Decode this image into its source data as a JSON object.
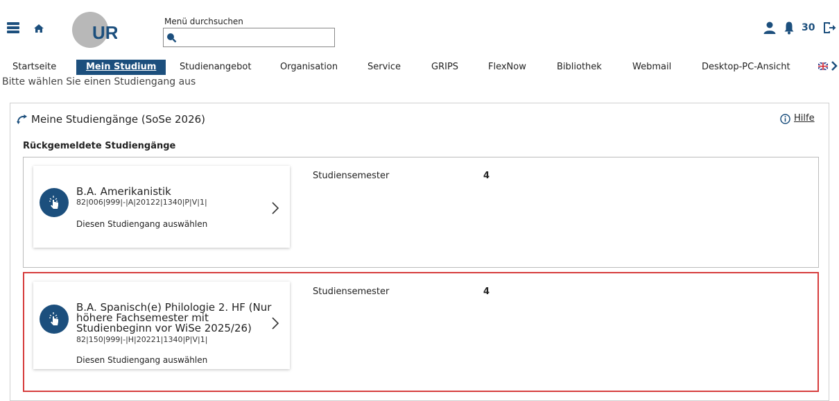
{
  "header": {
    "search_label": "Menü durchsuchen",
    "search_value": "",
    "notification_count": "30"
  },
  "nav": {
    "items": [
      "Startseite",
      "Mein Studium",
      "Studienangebot",
      "Organisation",
      "Service",
      "GRIPS",
      "FlexNow",
      "Bibliothek",
      "Webmail",
      "Desktop-PC-Ansicht"
    ],
    "active_index": 1
  },
  "page": {
    "title": "Bitte wählen Sie einen Studiengang aus",
    "panel_title": "Meine Studiengänge (SoSe 2026)",
    "help_label": "Hilfe",
    "section_title": "Rückgemeldete Studiengänge"
  },
  "courses": [
    {
      "title": "B.A. Amerikanistik",
      "code": "82|006|999|-|A|20122|1340|P|V|1|",
      "action": "Diesen Studiengang auswählen",
      "meta_label": "Studiensemester",
      "meta_value": "4"
    },
    {
      "title_lines": [
        "B.A. Spanisch(e) Philologie 2. HF (Nur",
        "höhere Fachsemester mit",
        "Studienbeginn vor WiSe 2025/26)"
      ],
      "code": "82|150|999|-|H|20221|1340|P|V|1|",
      "action": "Diesen Studiengang auswählen",
      "meta_label": "Studiensemester",
      "meta_value": "4"
    }
  ],
  "colors": {
    "primary": "#1c4f7d",
    "selected_border": "#d63c3c"
  }
}
